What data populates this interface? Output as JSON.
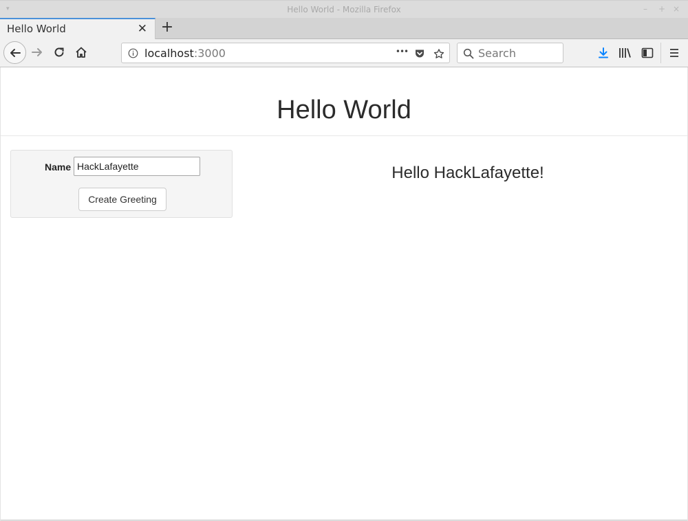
{
  "window": {
    "title": "Hello World - Mozilla Firefox",
    "menu_glyph": "▾",
    "controls": [
      "–",
      "+",
      "×"
    ]
  },
  "tabs": [
    {
      "label": "Hello World",
      "active": true,
      "close_glyph": "✕"
    }
  ],
  "new_tab_glyph": "+",
  "toolbar": {
    "url_host": "localhost",
    "url_port": ":3000",
    "url_more_glyph": "•••",
    "search_placeholder": "Search",
    "icons": [
      "back-arrow-icon",
      "forward-arrow-icon",
      "reload-icon",
      "home-icon",
      "info-icon",
      "pocket-icon",
      "bookmark-star-icon",
      "search-icon",
      "download-icon",
      "library-icon",
      "sidebar-icon",
      "hamburger-menu-icon"
    ],
    "accent_color": "#0a84ff"
  },
  "page": {
    "heading": "Hello World",
    "form": {
      "name_label": "Name",
      "name_value": "HackLafayette",
      "submit_label": "Create Greeting"
    },
    "greeting": "Hello HackLafayette!"
  }
}
